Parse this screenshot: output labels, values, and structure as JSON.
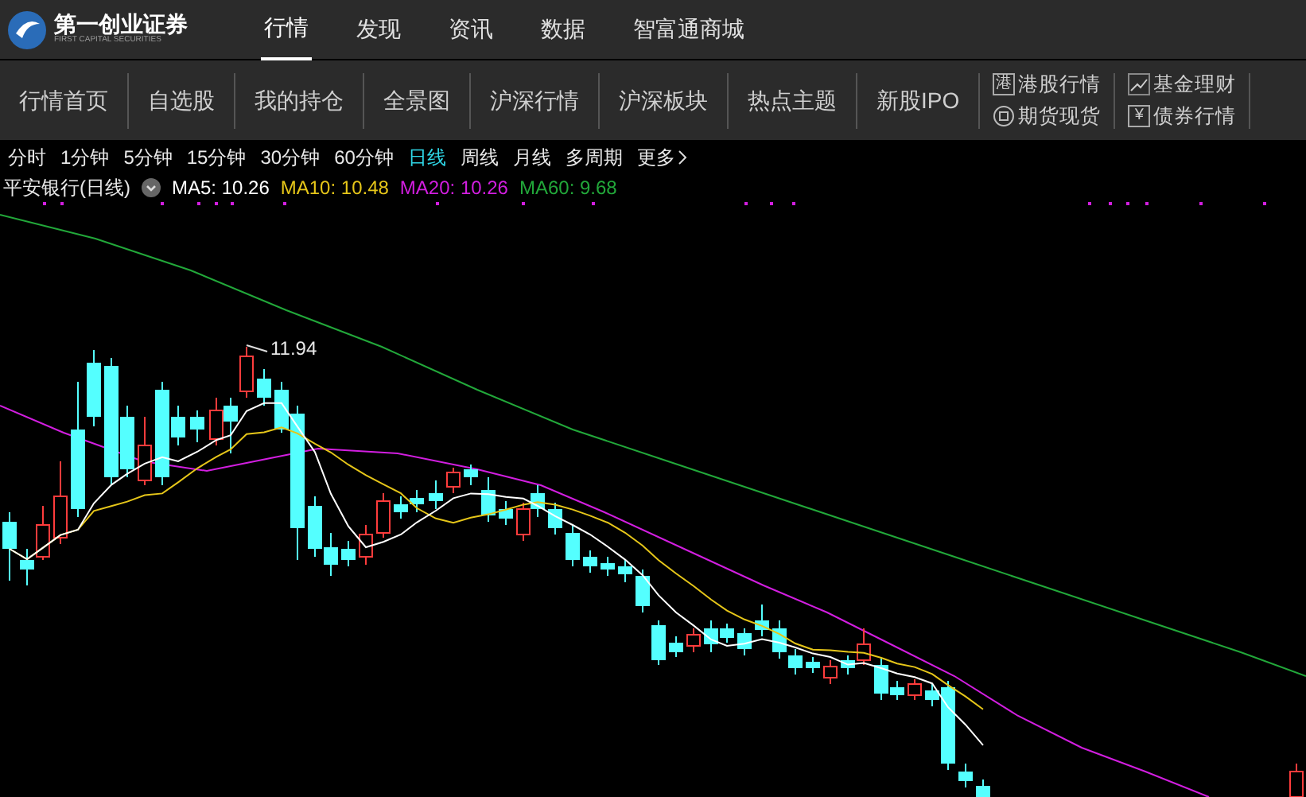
{
  "logo": {
    "name": "第一创业证券",
    "subtitle": "FIRST CAPITAL SECURITIES"
  },
  "top_nav": [
    {
      "label": "行情",
      "selected": true
    },
    {
      "label": "发现",
      "selected": false
    },
    {
      "label": "资讯",
      "selected": false
    },
    {
      "label": "数据",
      "selected": false
    },
    {
      "label": "智富通商城",
      "selected": false
    }
  ],
  "toolbar": {
    "tabs": [
      {
        "label": "行情首页",
        "selected": false
      },
      {
        "label": "自选股",
        "selected": false
      },
      {
        "label": "我的持仓",
        "selected": false
      },
      {
        "label": "全景图",
        "selected": false
      },
      {
        "label": "沪深行情",
        "selected": false
      },
      {
        "label": "沪深板块",
        "selected": false
      },
      {
        "label": "热点主题",
        "selected": false
      },
      {
        "label": "新股IPO",
        "selected": false
      }
    ],
    "shortcut_columns": [
      [
        {
          "kind": "glyph",
          "glyph": "港",
          "label": "港股行情"
        },
        {
          "kind": "circle",
          "label": "期货现货"
        }
      ],
      [
        {
          "kind": "trend",
          "label": "基金理财"
        },
        {
          "kind": "glyph",
          "glyph": "¥",
          "label": "债券行情"
        }
      ]
    ]
  },
  "periods": [
    {
      "label": "分时",
      "selected": false
    },
    {
      "label": "1分钟",
      "selected": false
    },
    {
      "label": "5分钟",
      "selected": false
    },
    {
      "label": "15分钟",
      "selected": false
    },
    {
      "label": "30分钟",
      "selected": false
    },
    {
      "label": "60分钟",
      "selected": false
    },
    {
      "label": "日线",
      "selected": true
    },
    {
      "label": "周线",
      "selected": false
    },
    {
      "label": "月线",
      "selected": false
    },
    {
      "label": "多周期",
      "selected": false
    },
    {
      "label": "更多",
      "selected": false
    }
  ],
  "legend": {
    "title": "平安银行(日线)",
    "averages": [
      {
        "label": "MA5: 10.26",
        "color": "#ffffff"
      },
      {
        "label": "MA10: 10.48",
        "color": "#e6c619"
      },
      {
        "label": "MA20: 10.26",
        "color": "#d21ee0"
      },
      {
        "label": "MA60: 9.68",
        "color": "#22a83a"
      }
    ]
  },
  "chart": {
    "high_label": "11.94"
  }
}
